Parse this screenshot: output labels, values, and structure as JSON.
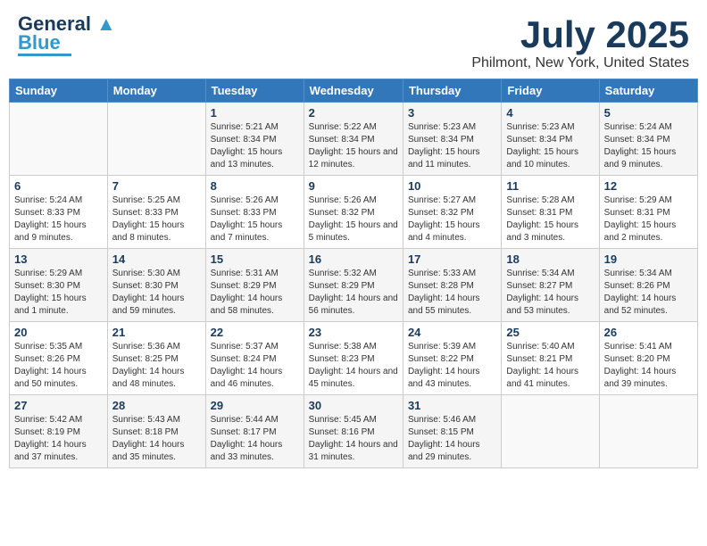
{
  "header": {
    "logo_main": "General",
    "logo_sub": "Blue",
    "month": "July 2025",
    "location": "Philmont, New York, United States"
  },
  "weekdays": [
    "Sunday",
    "Monday",
    "Tuesday",
    "Wednesday",
    "Thursday",
    "Friday",
    "Saturday"
  ],
  "weeks": [
    [
      {
        "day": "",
        "sunrise": "",
        "sunset": "",
        "daylight": ""
      },
      {
        "day": "",
        "sunrise": "",
        "sunset": "",
        "daylight": ""
      },
      {
        "day": "1",
        "sunrise": "Sunrise: 5:21 AM",
        "sunset": "Sunset: 8:34 PM",
        "daylight": "Daylight: 15 hours and 13 minutes."
      },
      {
        "day": "2",
        "sunrise": "Sunrise: 5:22 AM",
        "sunset": "Sunset: 8:34 PM",
        "daylight": "Daylight: 15 hours and 12 minutes."
      },
      {
        "day": "3",
        "sunrise": "Sunrise: 5:23 AM",
        "sunset": "Sunset: 8:34 PM",
        "daylight": "Daylight: 15 hours and 11 minutes."
      },
      {
        "day": "4",
        "sunrise": "Sunrise: 5:23 AM",
        "sunset": "Sunset: 8:34 PM",
        "daylight": "Daylight: 15 hours and 10 minutes."
      },
      {
        "day": "5",
        "sunrise": "Sunrise: 5:24 AM",
        "sunset": "Sunset: 8:34 PM",
        "daylight": "Daylight: 15 hours and 9 minutes."
      }
    ],
    [
      {
        "day": "6",
        "sunrise": "Sunrise: 5:24 AM",
        "sunset": "Sunset: 8:33 PM",
        "daylight": "Daylight: 15 hours and 9 minutes."
      },
      {
        "day": "7",
        "sunrise": "Sunrise: 5:25 AM",
        "sunset": "Sunset: 8:33 PM",
        "daylight": "Daylight: 15 hours and 8 minutes."
      },
      {
        "day": "8",
        "sunrise": "Sunrise: 5:26 AM",
        "sunset": "Sunset: 8:33 PM",
        "daylight": "Daylight: 15 hours and 7 minutes."
      },
      {
        "day": "9",
        "sunrise": "Sunrise: 5:26 AM",
        "sunset": "Sunset: 8:32 PM",
        "daylight": "Daylight: 15 hours and 5 minutes."
      },
      {
        "day": "10",
        "sunrise": "Sunrise: 5:27 AM",
        "sunset": "Sunset: 8:32 PM",
        "daylight": "Daylight: 15 hours and 4 minutes."
      },
      {
        "day": "11",
        "sunrise": "Sunrise: 5:28 AM",
        "sunset": "Sunset: 8:31 PM",
        "daylight": "Daylight: 15 hours and 3 minutes."
      },
      {
        "day": "12",
        "sunrise": "Sunrise: 5:29 AM",
        "sunset": "Sunset: 8:31 PM",
        "daylight": "Daylight: 15 hours and 2 minutes."
      }
    ],
    [
      {
        "day": "13",
        "sunrise": "Sunrise: 5:29 AM",
        "sunset": "Sunset: 8:30 PM",
        "daylight": "Daylight: 15 hours and 1 minute."
      },
      {
        "day": "14",
        "sunrise": "Sunrise: 5:30 AM",
        "sunset": "Sunset: 8:30 PM",
        "daylight": "Daylight: 14 hours and 59 minutes."
      },
      {
        "day": "15",
        "sunrise": "Sunrise: 5:31 AM",
        "sunset": "Sunset: 8:29 PM",
        "daylight": "Daylight: 14 hours and 58 minutes."
      },
      {
        "day": "16",
        "sunrise": "Sunrise: 5:32 AM",
        "sunset": "Sunset: 8:29 PM",
        "daylight": "Daylight: 14 hours and 56 minutes."
      },
      {
        "day": "17",
        "sunrise": "Sunrise: 5:33 AM",
        "sunset": "Sunset: 8:28 PM",
        "daylight": "Daylight: 14 hours and 55 minutes."
      },
      {
        "day": "18",
        "sunrise": "Sunrise: 5:34 AM",
        "sunset": "Sunset: 8:27 PM",
        "daylight": "Daylight: 14 hours and 53 minutes."
      },
      {
        "day": "19",
        "sunrise": "Sunrise: 5:34 AM",
        "sunset": "Sunset: 8:26 PM",
        "daylight": "Daylight: 14 hours and 52 minutes."
      }
    ],
    [
      {
        "day": "20",
        "sunrise": "Sunrise: 5:35 AM",
        "sunset": "Sunset: 8:26 PM",
        "daylight": "Daylight: 14 hours and 50 minutes."
      },
      {
        "day": "21",
        "sunrise": "Sunrise: 5:36 AM",
        "sunset": "Sunset: 8:25 PM",
        "daylight": "Daylight: 14 hours and 48 minutes."
      },
      {
        "day": "22",
        "sunrise": "Sunrise: 5:37 AM",
        "sunset": "Sunset: 8:24 PM",
        "daylight": "Daylight: 14 hours and 46 minutes."
      },
      {
        "day": "23",
        "sunrise": "Sunrise: 5:38 AM",
        "sunset": "Sunset: 8:23 PM",
        "daylight": "Daylight: 14 hours and 45 minutes."
      },
      {
        "day": "24",
        "sunrise": "Sunrise: 5:39 AM",
        "sunset": "Sunset: 8:22 PM",
        "daylight": "Daylight: 14 hours and 43 minutes."
      },
      {
        "day": "25",
        "sunrise": "Sunrise: 5:40 AM",
        "sunset": "Sunset: 8:21 PM",
        "daylight": "Daylight: 14 hours and 41 minutes."
      },
      {
        "day": "26",
        "sunrise": "Sunrise: 5:41 AM",
        "sunset": "Sunset: 8:20 PM",
        "daylight": "Daylight: 14 hours and 39 minutes."
      }
    ],
    [
      {
        "day": "27",
        "sunrise": "Sunrise: 5:42 AM",
        "sunset": "Sunset: 8:19 PM",
        "daylight": "Daylight: 14 hours and 37 minutes."
      },
      {
        "day": "28",
        "sunrise": "Sunrise: 5:43 AM",
        "sunset": "Sunset: 8:18 PM",
        "daylight": "Daylight: 14 hours and 35 minutes."
      },
      {
        "day": "29",
        "sunrise": "Sunrise: 5:44 AM",
        "sunset": "Sunset: 8:17 PM",
        "daylight": "Daylight: 14 hours and 33 minutes."
      },
      {
        "day": "30",
        "sunrise": "Sunrise: 5:45 AM",
        "sunset": "Sunset: 8:16 PM",
        "daylight": "Daylight: 14 hours and 31 minutes."
      },
      {
        "day": "31",
        "sunrise": "Sunrise: 5:46 AM",
        "sunset": "Sunset: 8:15 PM",
        "daylight": "Daylight: 14 hours and 29 minutes."
      },
      {
        "day": "",
        "sunrise": "",
        "sunset": "",
        "daylight": ""
      },
      {
        "day": "",
        "sunrise": "",
        "sunset": "",
        "daylight": ""
      }
    ]
  ]
}
